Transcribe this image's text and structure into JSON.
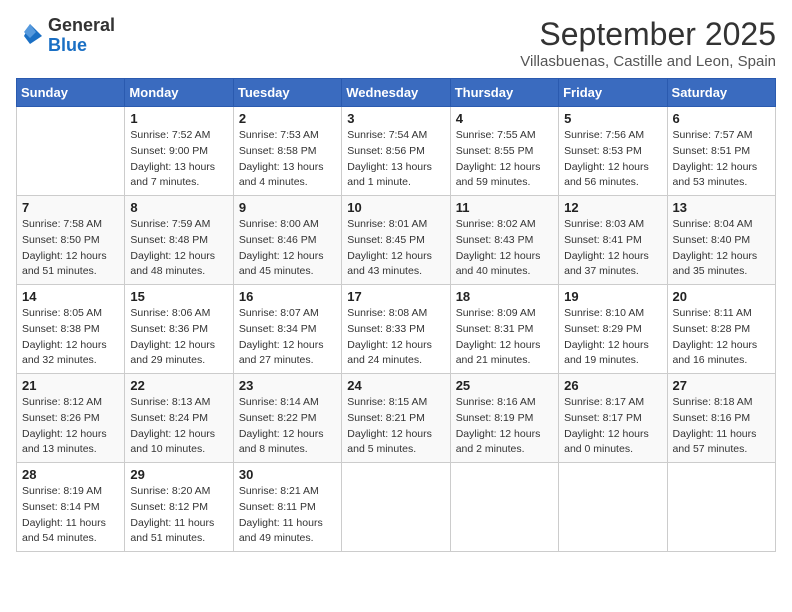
{
  "header": {
    "logo_general": "General",
    "logo_blue": "Blue",
    "month": "September 2025",
    "location": "Villasbuenas, Castille and Leon, Spain"
  },
  "days_of_week": [
    "Sunday",
    "Monday",
    "Tuesday",
    "Wednesday",
    "Thursday",
    "Friday",
    "Saturday"
  ],
  "weeks": [
    [
      {
        "day": "",
        "info": ""
      },
      {
        "day": "1",
        "info": "Sunrise: 7:52 AM\nSunset: 9:00 PM\nDaylight: 13 hours\nand 7 minutes."
      },
      {
        "day": "2",
        "info": "Sunrise: 7:53 AM\nSunset: 8:58 PM\nDaylight: 13 hours\nand 4 minutes."
      },
      {
        "day": "3",
        "info": "Sunrise: 7:54 AM\nSunset: 8:56 PM\nDaylight: 13 hours\nand 1 minute."
      },
      {
        "day": "4",
        "info": "Sunrise: 7:55 AM\nSunset: 8:55 PM\nDaylight: 12 hours\nand 59 minutes."
      },
      {
        "day": "5",
        "info": "Sunrise: 7:56 AM\nSunset: 8:53 PM\nDaylight: 12 hours\nand 56 minutes."
      },
      {
        "day": "6",
        "info": "Sunrise: 7:57 AM\nSunset: 8:51 PM\nDaylight: 12 hours\nand 53 minutes."
      }
    ],
    [
      {
        "day": "7",
        "info": "Sunrise: 7:58 AM\nSunset: 8:50 PM\nDaylight: 12 hours\nand 51 minutes."
      },
      {
        "day": "8",
        "info": "Sunrise: 7:59 AM\nSunset: 8:48 PM\nDaylight: 12 hours\nand 48 minutes."
      },
      {
        "day": "9",
        "info": "Sunrise: 8:00 AM\nSunset: 8:46 PM\nDaylight: 12 hours\nand 45 minutes."
      },
      {
        "day": "10",
        "info": "Sunrise: 8:01 AM\nSunset: 8:45 PM\nDaylight: 12 hours\nand 43 minutes."
      },
      {
        "day": "11",
        "info": "Sunrise: 8:02 AM\nSunset: 8:43 PM\nDaylight: 12 hours\nand 40 minutes."
      },
      {
        "day": "12",
        "info": "Sunrise: 8:03 AM\nSunset: 8:41 PM\nDaylight: 12 hours\nand 37 minutes."
      },
      {
        "day": "13",
        "info": "Sunrise: 8:04 AM\nSunset: 8:40 PM\nDaylight: 12 hours\nand 35 minutes."
      }
    ],
    [
      {
        "day": "14",
        "info": "Sunrise: 8:05 AM\nSunset: 8:38 PM\nDaylight: 12 hours\nand 32 minutes."
      },
      {
        "day": "15",
        "info": "Sunrise: 8:06 AM\nSunset: 8:36 PM\nDaylight: 12 hours\nand 29 minutes."
      },
      {
        "day": "16",
        "info": "Sunrise: 8:07 AM\nSunset: 8:34 PM\nDaylight: 12 hours\nand 27 minutes."
      },
      {
        "day": "17",
        "info": "Sunrise: 8:08 AM\nSunset: 8:33 PM\nDaylight: 12 hours\nand 24 minutes."
      },
      {
        "day": "18",
        "info": "Sunrise: 8:09 AM\nSunset: 8:31 PM\nDaylight: 12 hours\nand 21 minutes."
      },
      {
        "day": "19",
        "info": "Sunrise: 8:10 AM\nSunset: 8:29 PM\nDaylight: 12 hours\nand 19 minutes."
      },
      {
        "day": "20",
        "info": "Sunrise: 8:11 AM\nSunset: 8:28 PM\nDaylight: 12 hours\nand 16 minutes."
      }
    ],
    [
      {
        "day": "21",
        "info": "Sunrise: 8:12 AM\nSunset: 8:26 PM\nDaylight: 12 hours\nand 13 minutes."
      },
      {
        "day": "22",
        "info": "Sunrise: 8:13 AM\nSunset: 8:24 PM\nDaylight: 12 hours\nand 10 minutes."
      },
      {
        "day": "23",
        "info": "Sunrise: 8:14 AM\nSunset: 8:22 PM\nDaylight: 12 hours\nand 8 minutes."
      },
      {
        "day": "24",
        "info": "Sunrise: 8:15 AM\nSunset: 8:21 PM\nDaylight: 12 hours\nand 5 minutes."
      },
      {
        "day": "25",
        "info": "Sunrise: 8:16 AM\nSunset: 8:19 PM\nDaylight: 12 hours\nand 2 minutes."
      },
      {
        "day": "26",
        "info": "Sunrise: 8:17 AM\nSunset: 8:17 PM\nDaylight: 12 hours\nand 0 minutes."
      },
      {
        "day": "27",
        "info": "Sunrise: 8:18 AM\nSunset: 8:16 PM\nDaylight: 11 hours\nand 57 minutes."
      }
    ],
    [
      {
        "day": "28",
        "info": "Sunrise: 8:19 AM\nSunset: 8:14 PM\nDaylight: 11 hours\nand 54 minutes."
      },
      {
        "day": "29",
        "info": "Sunrise: 8:20 AM\nSunset: 8:12 PM\nDaylight: 11 hours\nand 51 minutes."
      },
      {
        "day": "30",
        "info": "Sunrise: 8:21 AM\nSunset: 8:11 PM\nDaylight: 11 hours\nand 49 minutes."
      },
      {
        "day": "",
        "info": ""
      },
      {
        "day": "",
        "info": ""
      },
      {
        "day": "",
        "info": ""
      },
      {
        "day": "",
        "info": ""
      }
    ]
  ]
}
